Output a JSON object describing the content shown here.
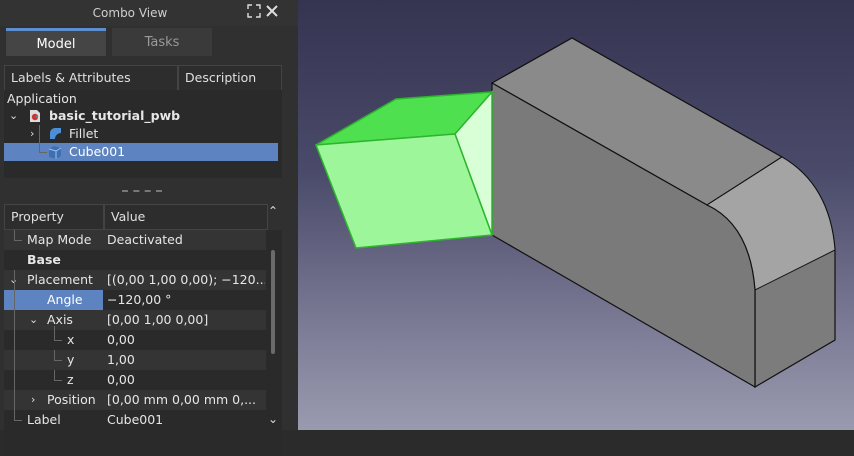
{
  "window": {
    "title": "Combo View"
  },
  "tabs": [
    {
      "label": "Model"
    },
    {
      "label": "Tasks"
    }
  ],
  "tree_header": {
    "col1": "Labels & Attributes",
    "col2": "Description"
  },
  "tree": {
    "section": "Application",
    "document": "basic_tutorial_pwb",
    "items": [
      {
        "label": "Fillet"
      },
      {
        "label": "Cube001"
      }
    ]
  },
  "props_header": {
    "col1": "Property",
    "col2": "Value"
  },
  "properties": {
    "map_mode": {
      "key": "Map Mode",
      "value": "Deactivated"
    },
    "base_group": "Base",
    "placement": {
      "key": "Placement",
      "value": "[(0,00 1,00 0,00); −120...."
    },
    "angle": {
      "key": "Angle",
      "value": "−120,00 °"
    },
    "axis": {
      "key": "Axis",
      "value": "[0,00 1,00 0,00]"
    },
    "x": {
      "key": "x",
      "value": "0,00"
    },
    "y": {
      "key": "y",
      "value": "1,00"
    },
    "z": {
      "key": "z",
      "value": "0,00"
    },
    "position": {
      "key": "Position",
      "value": "[0,00 mm  0,00 mm  0,..."
    },
    "label": {
      "key": "Label",
      "value": "Cube001"
    }
  },
  "icons": [
    "undock-icon",
    "close-icon",
    "document-icon",
    "fillet-icon",
    "cube-icon",
    "chevron-up-icon",
    "chevron-down-icon"
  ],
  "colors": {
    "selection": "#5d84c0",
    "selected_shape": "#9df79a",
    "shape_gray": "#7d7d7d"
  }
}
